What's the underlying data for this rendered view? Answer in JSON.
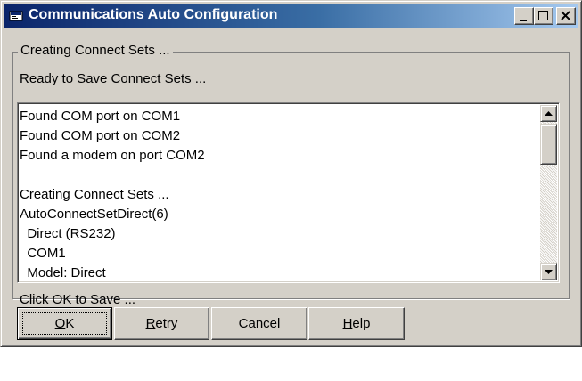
{
  "window": {
    "title": "Communications Auto Configuration",
    "colors": {
      "face": "#d4d0c8",
      "titlebar_start": "#0a246a",
      "titlebar_end": "#a6caf0",
      "title_text": "#ffffff"
    },
    "caption_buttons": {
      "minimize": "minimize-icon",
      "maximize": "maximize-icon",
      "close": "close-icon"
    }
  },
  "group": {
    "legend": "Creating Connect Sets ...",
    "status_top": "Ready to Save Connect Sets ...",
    "status_bottom": "Click OK to Save ..."
  },
  "log": {
    "lines": [
      "Found COM port on COM1",
      "Found COM port on COM2",
      "Found a modem on port COM2",
      "",
      "Creating Connect Sets ...",
      "AutoConnectSetDirect(6)",
      "  Direct (RS232)",
      "  COM1",
      "  Model: Direct"
    ]
  },
  "buttons": {
    "ok": {
      "mnemonic": "O",
      "rest": "K"
    },
    "retry": {
      "mnemonic": "R",
      "rest": "etry"
    },
    "cancel": {
      "label": "Cancel"
    },
    "help": {
      "mnemonic": "H",
      "rest": "elp"
    }
  }
}
